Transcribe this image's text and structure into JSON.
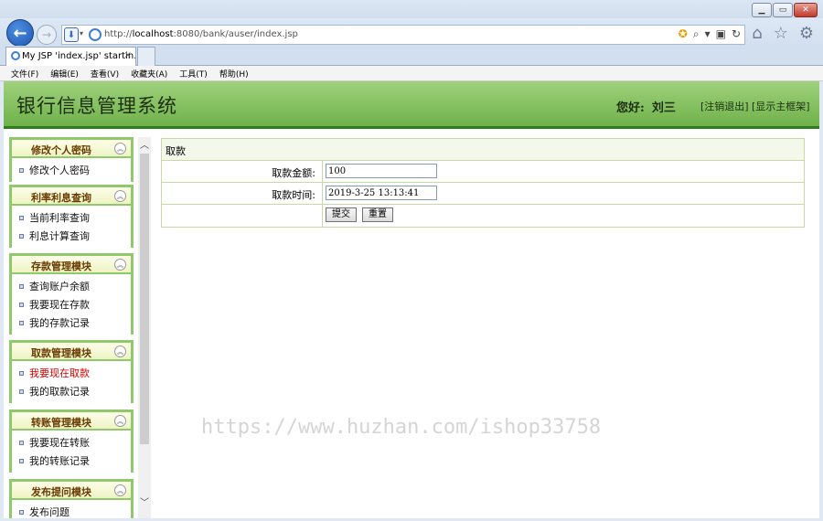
{
  "browser": {
    "address_url_prefix": "http://",
    "address_url_host": "localhost",
    "address_url_rest": ":8080/bank/auser/index.jsp",
    "tab_title": "My JSP 'index.jsp' startin...",
    "tab_close": "×",
    "menu": [
      "文件(F)",
      "编辑(E)",
      "查看(V)",
      "收藏夹(A)",
      "工具(T)",
      "帮助(H)"
    ]
  },
  "header": {
    "system_title": "银行信息管理系统",
    "greeting": "您好:",
    "user_name": "刘三",
    "logout_link": "[注销退出]",
    "main_frame_link": "[显示主框架]"
  },
  "sidebar": {
    "sections": [
      {
        "title": "修改个人密码",
        "items": [
          "修改个人密码"
        ]
      },
      {
        "title": "利率利息查询",
        "items": [
          "当前利率查询",
          "利息计算查询"
        ]
      },
      {
        "title": "存款管理模块",
        "items": [
          "查询账户余额",
          "我要现在存款",
          "我的存款记录"
        ]
      },
      {
        "title": "取款管理模块",
        "items": [
          "我要现在取款",
          "我的取款记录"
        ]
      },
      {
        "title": "转账管理模块",
        "items": [
          "我要现在转账",
          "我的转账记录"
        ]
      },
      {
        "title": "发布提问模块",
        "items": [
          "发布问题"
        ]
      }
    ],
    "active_item": "我要现在取款"
  },
  "form": {
    "title": "取款",
    "amount_label": "取款金额:",
    "amount_value": "100",
    "time_label": "取款时间:",
    "time_value": "2019-3-25 13:13:41",
    "submit_label": "提交",
    "reset_label": "重置"
  },
  "watermark": "https://www.huzhan.com/ishop33758",
  "colors": {
    "header_green": "#6fb24a",
    "header_border": "#2f7d1b",
    "section_border": "#8fc96b",
    "section_title": "#6a3b00",
    "active_link": "#d10000"
  }
}
